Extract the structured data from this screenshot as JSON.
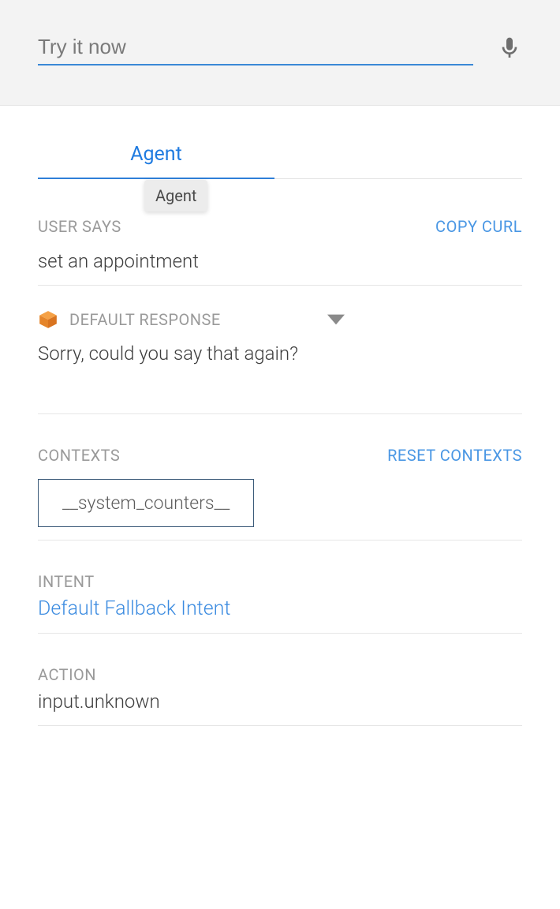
{
  "search": {
    "placeholder": "Try it now",
    "value": ""
  },
  "tabs": {
    "active_label": "Agent",
    "tooltip": "Agent"
  },
  "user_says": {
    "label": "USER SAYS",
    "copy_link": "COPY CURL",
    "value": "set an appointment"
  },
  "response": {
    "label": "DEFAULT RESPONSE",
    "text": "Sorry, could you say that again?"
  },
  "contexts": {
    "label": "CONTEXTS",
    "reset_link": "RESET CONTEXTS",
    "chips": [
      "__system_counters__"
    ]
  },
  "intent": {
    "label": "INTENT",
    "value": "Default Fallback Intent"
  },
  "action": {
    "label": "ACTION",
    "value": "input.unknown"
  }
}
